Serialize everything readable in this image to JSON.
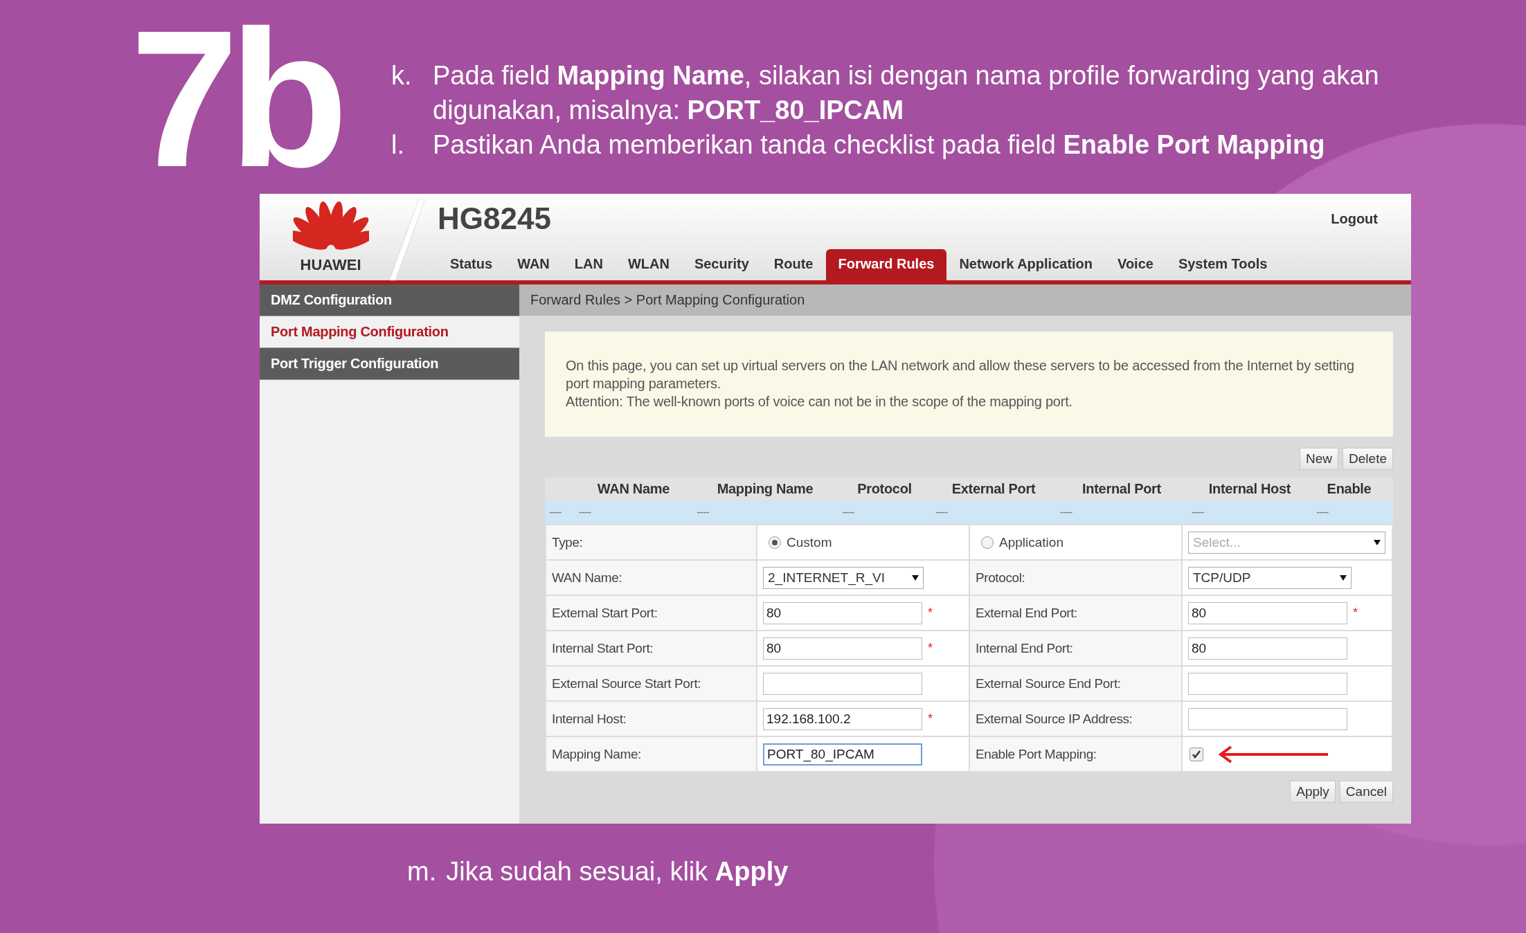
{
  "step": "7b",
  "instructions": [
    {
      "marker": "k.",
      "text": "Pada field **Mapping Name**, silakan isi dengan nama profile forwarding yang akan digunakan, misalnya: **PORT_80_IPCAM**"
    },
    {
      "marker": "l.",
      "text": "Pastikan Anda memberikan tanda checklist pada field **Enable Port Mapping**"
    }
  ],
  "router": {
    "logo_text": "HUAWEI",
    "model": "HG8245",
    "logout": "Logout",
    "nav": [
      {
        "label": "Status",
        "selected": false
      },
      {
        "label": "WAN",
        "selected": false
      },
      {
        "label": "LAN",
        "selected": false
      },
      {
        "label": "WLAN",
        "selected": false
      },
      {
        "label": "Security",
        "selected": false
      },
      {
        "label": "Route",
        "selected": false
      },
      {
        "label": "Forward Rules",
        "selected": true
      },
      {
        "label": "Network Application",
        "selected": false
      },
      {
        "label": "Voice",
        "selected": false
      },
      {
        "label": "System Tools",
        "selected": false
      }
    ],
    "sidebar": [
      {
        "label": "DMZ Configuration",
        "selected": false
      },
      {
        "label": "Port Mapping Configuration",
        "selected": true
      },
      {
        "label": "Port Trigger Configuration",
        "selected": false
      }
    ],
    "breadcrumb": "Forward Rules > Port Mapping Configuration",
    "info": [
      "On this page, you can set up virtual servers on the LAN network and allow these servers to be accessed from the Internet by setting port mapping parameters.",
      "Attention: The well-known ports of voice can not be in the scope of the mapping port."
    ],
    "table_buttons": [
      "New",
      "Delete"
    ],
    "columns": [
      "WAN Name",
      "Mapping Name",
      "Protocol",
      "External Port",
      "Internal Port",
      "Internal Host",
      "Enable"
    ],
    "empty_row": [
      "----",
      "----",
      "----",
      "----",
      "----",
      "----",
      "----",
      "----"
    ],
    "form": [
      [
        {
          "kind": "label",
          "text": "Type:"
        },
        {
          "kind": "radio",
          "label": "Custom",
          "selected": true
        },
        {
          "kind": "radio",
          "label": "Application",
          "selected": false
        },
        {
          "kind": "select",
          "placeholder": "Select..."
        }
      ],
      [
        {
          "kind": "label",
          "text": "WAN Name:"
        },
        {
          "kind": "select",
          "value": "2_INTERNET_R_VI"
        },
        {
          "kind": "label",
          "text": "Protocol:"
        },
        {
          "kind": "select",
          "value": "TCP/UDP"
        }
      ],
      [
        {
          "kind": "label",
          "text": "External Start Port:"
        },
        {
          "kind": "text",
          "value": "80",
          "required_mark": "*"
        },
        {
          "kind": "label",
          "text": "External End Port:"
        },
        {
          "kind": "text",
          "value": "80",
          "required_mark": "*"
        }
      ],
      [
        {
          "kind": "label",
          "text": "Internal Start Port:"
        },
        {
          "kind": "text",
          "value": "80",
          "required_mark": "*"
        },
        {
          "kind": "label",
          "text": "Internal End Port:"
        },
        {
          "kind": "text",
          "value": "80"
        }
      ],
      [
        {
          "kind": "label",
          "text": "External Source Start Port:"
        },
        {
          "kind": "text"
        },
        {
          "kind": "label",
          "text": "External Source End Port:"
        },
        {
          "kind": "text"
        }
      ],
      [
        {
          "kind": "label",
          "text": "Internal Host:"
        },
        {
          "kind": "text",
          "value": "192.168.100.2",
          "required_mark": "*"
        },
        {
          "kind": "label",
          "text": "External Source IP Address:"
        },
        {
          "kind": "text"
        }
      ],
      [
        {
          "kind": "label",
          "text": "Mapping Name:"
        },
        {
          "kind": "text",
          "value": "PORT_80_IPCAM",
          "focused": true
        },
        {
          "kind": "label",
          "text": "Enable Port Mapping:"
        },
        {
          "kind": "checkbox",
          "checked": true,
          "pointer": true
        }
      ]
    ],
    "actions": [
      "Apply",
      "Cancel"
    ]
  },
  "footer": {
    "marker": "m.",
    "text": "Jika sudah sesuai, klik **Apply**"
  }
}
